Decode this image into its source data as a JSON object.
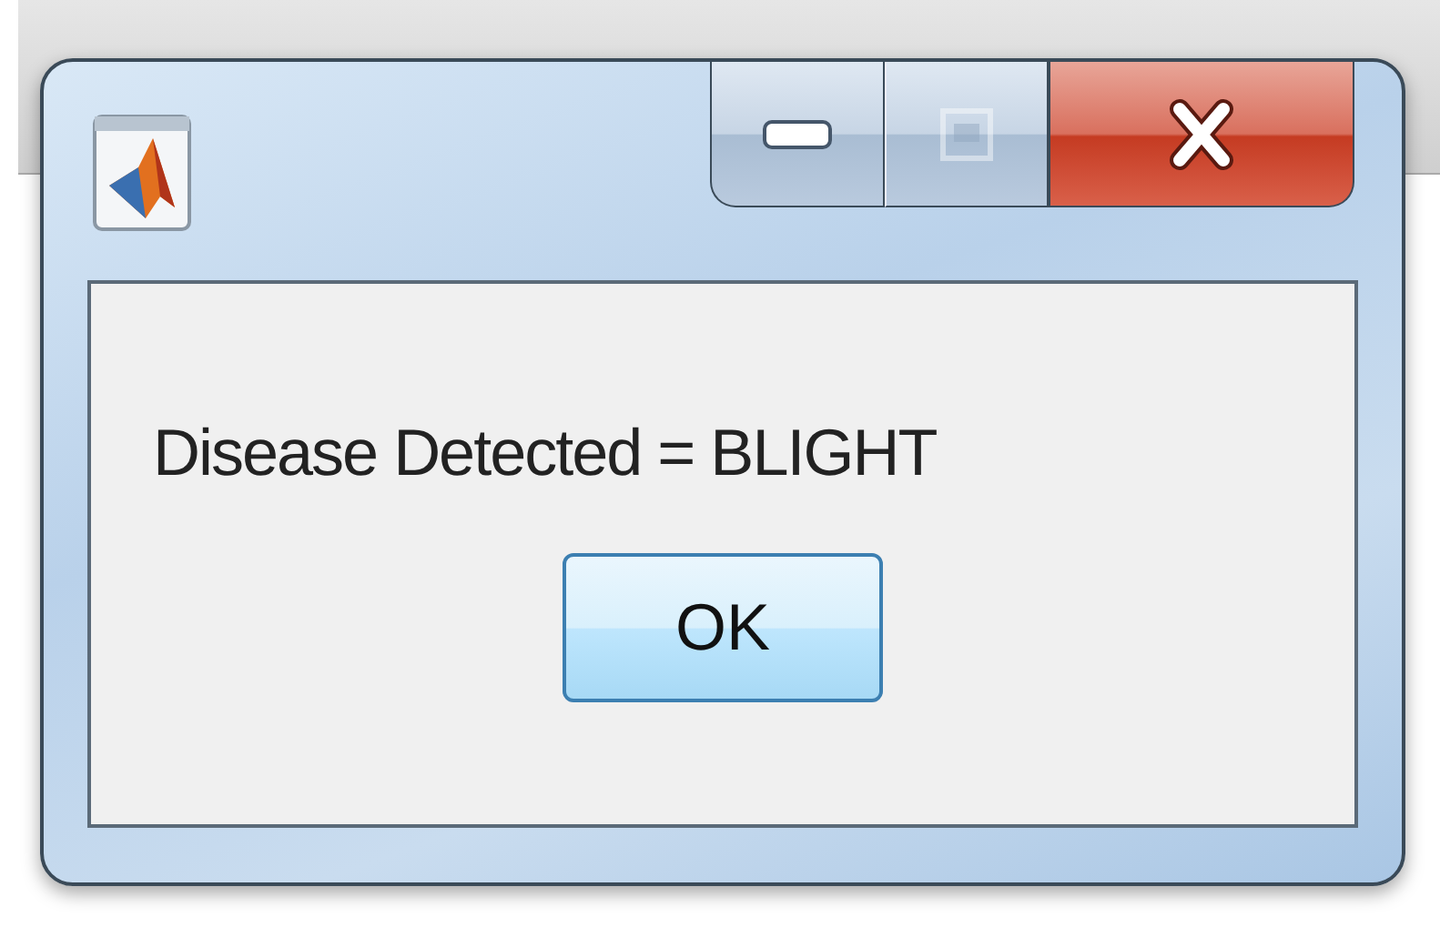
{
  "window": {
    "maximize_disabled": true
  },
  "message": "Disease Detected = BLIGHT",
  "buttons": [
    "OK"
  ]
}
